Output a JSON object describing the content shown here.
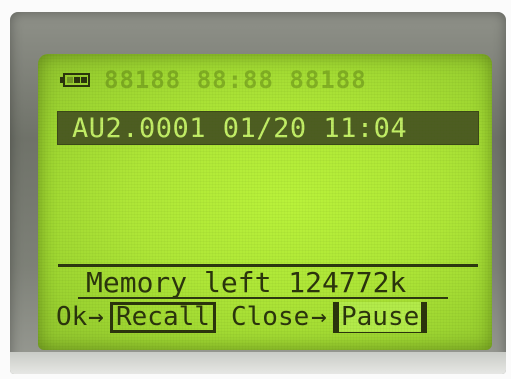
{
  "device": {
    "status": {
      "battery_icon": "battery-icon",
      "ghost_segments": "88188 88:88 88188"
    },
    "header": {
      "text": "AU2.0001 01/20 11:04"
    },
    "footer": {
      "memory_label": "Memory left 124772k",
      "softkeys": {
        "ok_label": "Ok",
        "ok_arrow": "→",
        "recall_label": "Recall",
        "close_label": "Close",
        "close_arrow": "→",
        "pause_label": "Pause"
      }
    },
    "colors": {
      "lcd_green": "#b3eb4a",
      "lcd_dark": "#2a330d",
      "header_bg": "#4d5d22"
    }
  }
}
